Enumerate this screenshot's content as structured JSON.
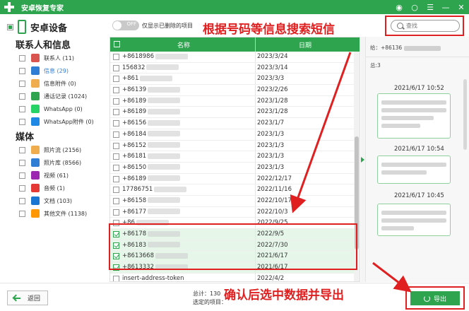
{
  "titlebar": {
    "title": "安卓恢复专家"
  },
  "device": {
    "label": "安卓设备"
  },
  "sections": {
    "contacts_info": "联系人和信息",
    "media": "媒体"
  },
  "categories": [
    {
      "label": "联系人 (11)",
      "icon": "contacts-icon",
      "color": "#d9534f"
    },
    {
      "label": "信息 (29)",
      "icon": "message-icon",
      "color": "#2e7ed6",
      "active": true
    },
    {
      "label": "信息附件 (0)",
      "icon": "attachment-icon",
      "color": "#f0ad4e"
    },
    {
      "label": "通话记录 (1024)",
      "icon": "phone-call-icon",
      "color": "#2ea44f"
    },
    {
      "label": "WhatsApp (0)",
      "icon": "whatsapp-icon",
      "color": "#25d366"
    },
    {
      "label": "WhatsApp附件 (0)",
      "icon": "whatsapp-attachment-icon",
      "color": "#1e88e5"
    }
  ],
  "media_categories": [
    {
      "label": "照片流 (2156)",
      "icon": "photo-stream-icon",
      "color": "#f0ad4e"
    },
    {
      "label": "照片库 (8566)",
      "icon": "photo-library-icon",
      "color": "#2e7ed6"
    },
    {
      "label": "视频 (61)",
      "icon": "video-icon",
      "color": "#9c27b0"
    },
    {
      "label": "音频 (1)",
      "icon": "audio-icon",
      "color": "#e53935"
    },
    {
      "label": "文档 (103)",
      "icon": "document-icon",
      "color": "#1976d2"
    },
    {
      "label": "其他文件 (1138)",
      "icon": "other-files-icon",
      "color": "#ff9800"
    }
  ],
  "toolbar": {
    "toggle_label": "OFF",
    "toggle_text": "仅显示已删除的项目",
    "search_placeholder": "查找"
  },
  "table": {
    "headers": {
      "name": "名称",
      "date": "日期"
    },
    "rows": [
      {
        "name": "+8618986",
        "date": "2023/3/24",
        "checked": false
      },
      {
        "name": "156832",
        "date": "2023/3/14",
        "checked": false
      },
      {
        "name": "+861",
        "date": "2023/3/3",
        "checked": false
      },
      {
        "name": "+86139",
        "date": "2023/2/26",
        "checked": false
      },
      {
        "name": "+86189",
        "date": "2023/1/28",
        "checked": false
      },
      {
        "name": "+86189",
        "date": "2023/1/28",
        "checked": false
      },
      {
        "name": "+86156",
        "date": "2023/1/7",
        "checked": false
      },
      {
        "name": "+86184",
        "date": "2023/1/3",
        "checked": false
      },
      {
        "name": "+86152",
        "date": "2023/1/3",
        "checked": false
      },
      {
        "name": "+86181",
        "date": "2023/1/3",
        "checked": false
      },
      {
        "name": "+86150",
        "date": "2023/1/3",
        "checked": false
      },
      {
        "name": "+86189",
        "date": "2022/12/17",
        "checked": false
      },
      {
        "name": "17786751",
        "date": "2022/11/16",
        "checked": false
      },
      {
        "name": "+86158",
        "date": "2022/10/17",
        "checked": false
      },
      {
        "name": "+86177",
        "date": "2022/10/3",
        "checked": false
      },
      {
        "name": "+86",
        "date": "2022/9/25",
        "checked": false
      },
      {
        "name": "+86178",
        "date": "2022/9/5",
        "checked": true
      },
      {
        "name": "+86183",
        "date": "2022/7/30",
        "checked": true
      },
      {
        "name": "+8613668",
        "date": "2021/6/17",
        "checked": true
      },
      {
        "name": "+8613332",
        "date": "2021/6/17",
        "checked": true
      },
      {
        "name": "insert-address-token",
        "date": "2022/4/2",
        "checked": false
      }
    ]
  },
  "detail": {
    "to_label": "给：+86136",
    "count_label": "总:3",
    "messages": [
      {
        "time": "2021/6/17 10:52"
      },
      {
        "time": "2021/6/17 10:54"
      },
      {
        "time": "2021/6/17 10:45"
      }
    ]
  },
  "bottombar": {
    "back_label": "返回",
    "total_label": "总计：130",
    "selected_label": "选定的项目：",
    "export_label": "导出"
  },
  "annotations": {
    "search_hint": "根据号码等信息搜索短信",
    "export_hint": "确认后选中数据并导出"
  },
  "colors": {
    "accent": "#2ea44f",
    "annotation": "#e02020",
    "link_active": "#2e7ed6"
  }
}
